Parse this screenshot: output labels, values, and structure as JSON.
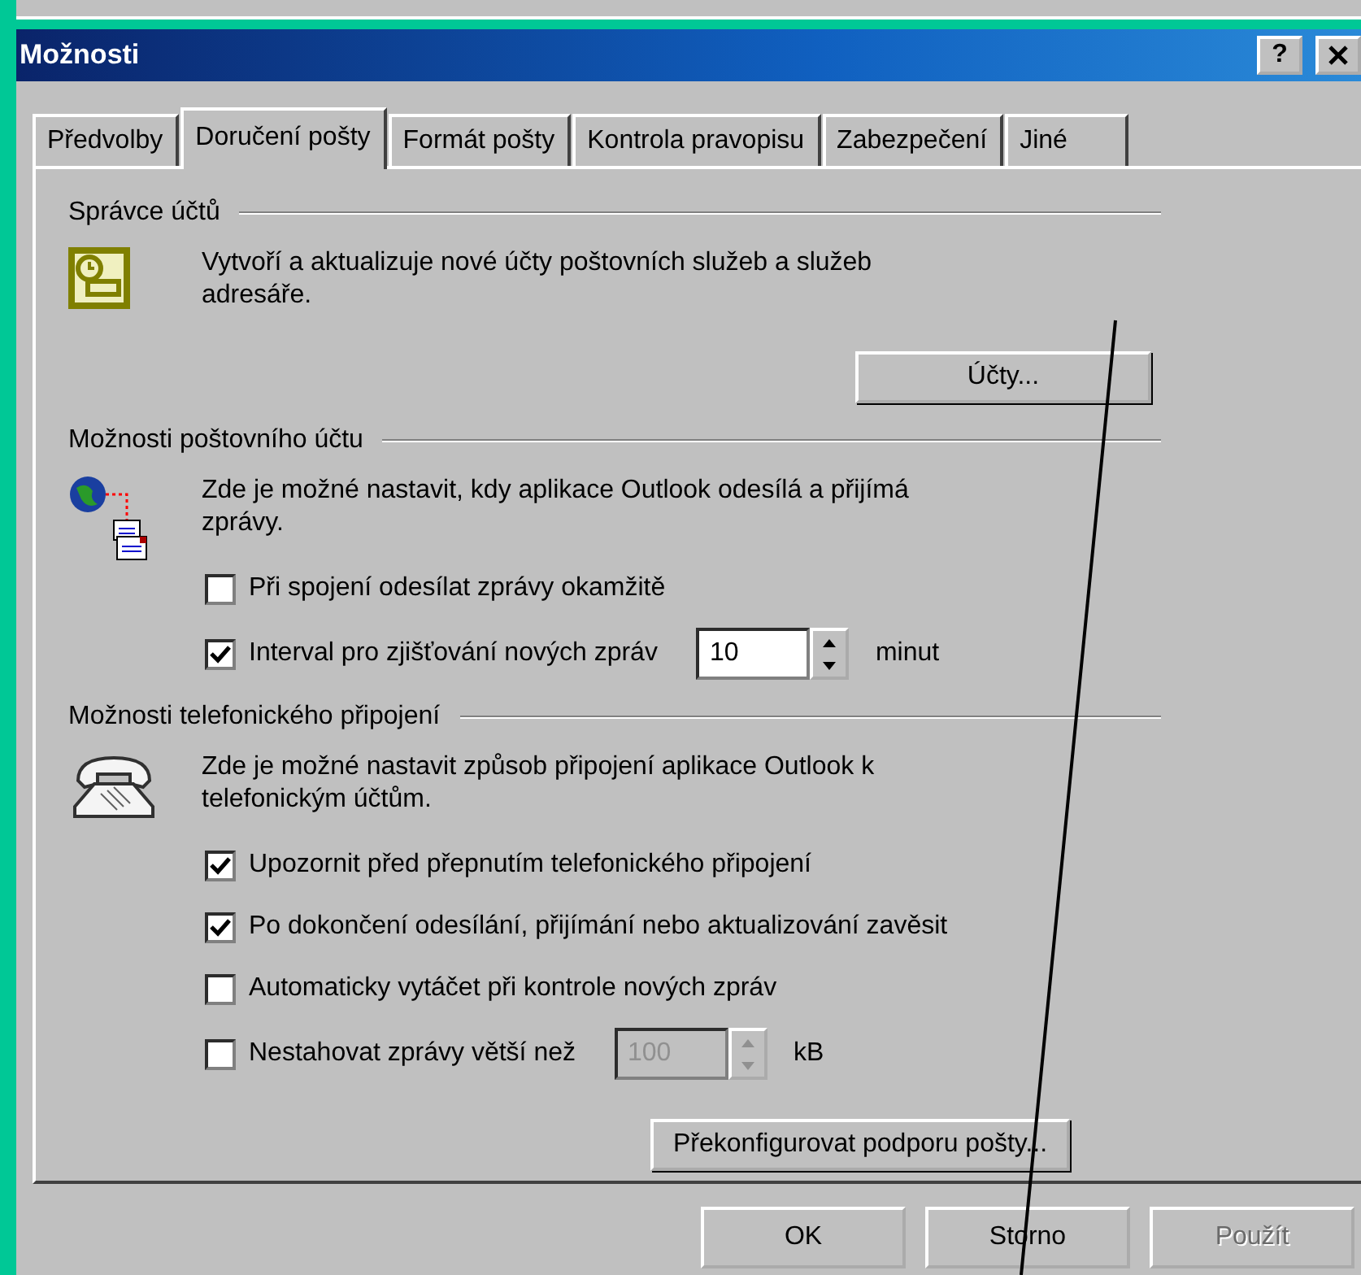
{
  "window": {
    "title": "Možnosti",
    "help_button": "?"
  },
  "tabs": [
    {
      "label": "Předvolby",
      "selected": false
    },
    {
      "label": "Doručení pošty",
      "selected": true
    },
    {
      "label": "Formát pošty",
      "selected": false
    },
    {
      "label": "Kontrola pravopisu",
      "selected": false
    },
    {
      "label": "Zabezpečení",
      "selected": false
    },
    {
      "label": "Jiné",
      "selected": false
    }
  ],
  "sections": [
    {
      "kind": "accounts",
      "heading": "Správce účtů",
      "description": "Vytvoří a aktualizuje nové účty poštovních služeb a služeb adresáře.",
      "items": [
        {
          "kind": "button",
          "label": "Účty..."
        }
      ]
    },
    {
      "kind": "mail",
      "heading": "Možnosti poštovního účtu",
      "description": "Zde je možné nastavit, kdy aplikace Outlook odesílá a přijímá zprávy.",
      "items": [
        {
          "kind": "checkbox",
          "label": "Při spojení odesílat zprávy okamžitě",
          "checked": false
        },
        {
          "kind": "checkbox_spin",
          "label": "Interval pro zjišťování nových zpráv",
          "checked": true,
          "value": "10",
          "unit": "minut",
          "disabled": false
        }
      ]
    },
    {
      "kind": "dialup",
      "heading": "Možnosti telefonického připojení",
      "description": "Zde je možné nastavit způsob připojení aplikace Outlook k telefonickým účtům.",
      "items": [
        {
          "kind": "checkbox",
          "label": "Upozornit před přepnutím telefonického připojení",
          "checked": true
        },
        {
          "kind": "checkbox",
          "label": "Po dokončení odesílání, přijímání nebo aktualizování zavěsit",
          "checked": true
        },
        {
          "kind": "checkbox",
          "label": "Automaticky vytáčet při kontrole nových zpráv",
          "checked": false
        },
        {
          "kind": "checkbox_spin",
          "label": "Nestahovat zprávy větší než",
          "checked": false,
          "value": "100",
          "unit": "kB",
          "disabled": true
        },
        {
          "kind": "button",
          "label": "Překonfigurovat podporu pošty..."
        }
      ]
    }
  ],
  "buttons": [
    {
      "label": "OK",
      "disabled": false
    },
    {
      "label": "Storno",
      "disabled": false
    },
    {
      "label": "Použít",
      "disabled": true
    }
  ]
}
